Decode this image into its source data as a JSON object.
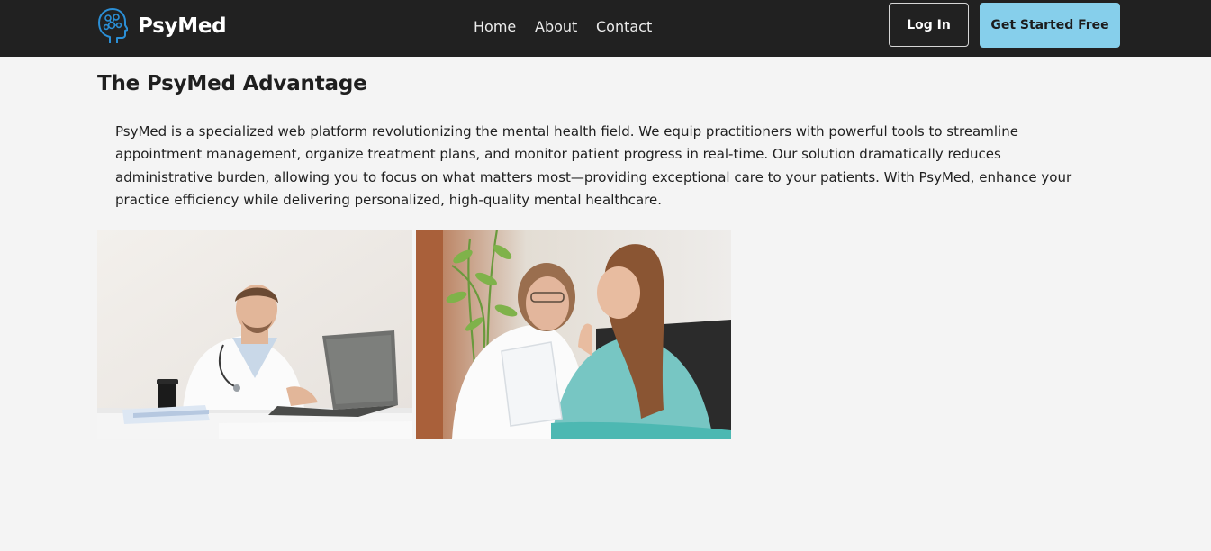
{
  "nav": {
    "brand": "PsyMed",
    "links": [
      {
        "label": "Home"
      },
      {
        "label": "About"
      },
      {
        "label": "Contact"
      }
    ],
    "login_label": "Log In",
    "cta_label": "Get Started Free"
  },
  "main": {
    "title": "The PsyMed Advantage",
    "description": "PsyMed is a specialized web platform revolutionizing the mental health field. We equip practitioners with powerful tools to streamline appointment management, organize treatment plans, and monitor patient progress in real-time. Our solution dramatically reduces administrative burden, allowing you to focus on what matters most—providing exceptional care to your patients. With PsyMed, enhance your practice efficiency while delivering personalized, high-quality mental healthcare."
  },
  "icons": {
    "logo": "brain-head-icon"
  },
  "colors": {
    "navbar_bg": "#212121",
    "page_bg": "#f4f4f4",
    "cta_bg": "#86cfeb",
    "logo_blue": "#2b8fd6"
  }
}
